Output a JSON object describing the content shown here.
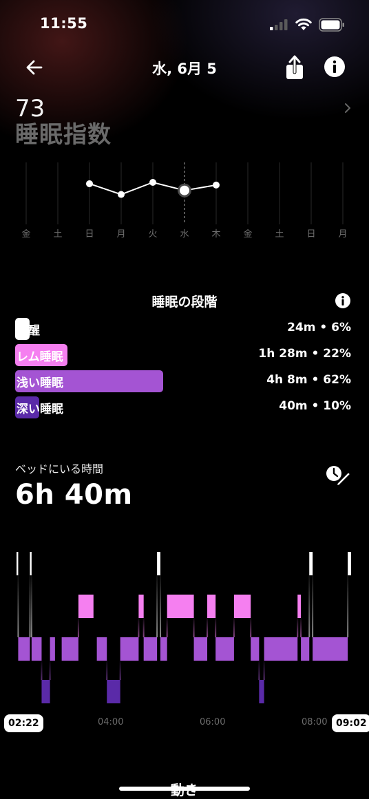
{
  "status": {
    "time": "11:55"
  },
  "header": {
    "date": "水, 6月 5"
  },
  "score": {
    "value": "73",
    "label": "睡眠指数"
  },
  "week": {
    "days": [
      "金",
      "土",
      "日",
      "月",
      "火",
      "水",
      "木",
      "金",
      "土",
      "日",
      "月"
    ],
    "values": [
      null,
      null,
      78,
      70,
      79,
      73,
      77,
      null,
      null,
      null,
      null
    ],
    "selected_index": 5
  },
  "stages": {
    "title": "睡眠の段階",
    "items": [
      {
        "label": "覚醒",
        "value": "24m • 6%",
        "percent": 6,
        "color": "#ffffff"
      },
      {
        "label": "レム睡眠",
        "value": "1h 28m • 22%",
        "percent": 22,
        "color": "#f57ff0"
      },
      {
        "label": "浅い睡眠",
        "value": "4h 8m • 62%",
        "percent": 62,
        "color": "#a454d3"
      },
      {
        "label": "深い睡眠",
        "value": "40m • 10%",
        "percent": 10,
        "color": "#5a2aa8"
      }
    ]
  },
  "in_bed": {
    "label": "ベッドにいる時間",
    "value": "6h 40m"
  },
  "hypnogram": {
    "start_label": "02:22",
    "end_label": "09:02",
    "ticks": [
      "04:00",
      "06:00",
      "08:00"
    ],
    "colors": {
      "awake": "#ffffff",
      "rem": "#f57ff0",
      "light": "#a454d3",
      "deep": "#5a2aa8"
    },
    "segments": [
      {
        "stage": "awake",
        "start": "02:22",
        "end": "02:24"
      },
      {
        "stage": "light",
        "start": "02:24",
        "end": "02:38"
      },
      {
        "stage": "awake",
        "start": "02:38",
        "end": "02:40"
      },
      {
        "stage": "light",
        "start": "02:40",
        "end": "02:52"
      },
      {
        "stage": "deep",
        "start": "02:52",
        "end": "03:02"
      },
      {
        "stage": "light",
        "start": "03:02",
        "end": "03:08"
      },
      {
        "stage": "light",
        "start": "03:16",
        "end": "03:36"
      },
      {
        "stage": "rem",
        "start": "03:36",
        "end": "03:54"
      },
      {
        "stage": "light",
        "start": "03:58",
        "end": "04:10"
      },
      {
        "stage": "deep",
        "start": "04:10",
        "end": "04:26"
      },
      {
        "stage": "light",
        "start": "04:26",
        "end": "04:48"
      },
      {
        "stage": "rem",
        "start": "04:48",
        "end": "04:54"
      },
      {
        "stage": "light",
        "start": "04:54",
        "end": "05:10"
      },
      {
        "stage": "awake",
        "start": "05:10",
        "end": "05:14"
      },
      {
        "stage": "light",
        "start": "05:14",
        "end": "05:22"
      },
      {
        "stage": "rem",
        "start": "05:22",
        "end": "05:54"
      },
      {
        "stage": "light",
        "start": "05:54",
        "end": "06:10"
      },
      {
        "stage": "rem",
        "start": "06:10",
        "end": "06:20"
      },
      {
        "stage": "light",
        "start": "06:20",
        "end": "06:42"
      },
      {
        "stage": "rem",
        "start": "06:42",
        "end": "07:02"
      },
      {
        "stage": "light",
        "start": "07:02",
        "end": "07:12"
      },
      {
        "stage": "deep",
        "start": "07:12",
        "end": "07:18"
      },
      {
        "stage": "light",
        "start": "07:18",
        "end": "07:58"
      },
      {
        "stage": "rem",
        "start": "07:58",
        "end": "08:02"
      },
      {
        "stage": "light",
        "start": "08:02",
        "end": "08:12"
      },
      {
        "stage": "awake",
        "start": "08:12",
        "end": "08:16"
      },
      {
        "stage": "light",
        "start": "08:16",
        "end": "08:58"
      },
      {
        "stage": "awake",
        "start": "08:58",
        "end": "09:02"
      }
    ]
  },
  "bottom": {
    "label": "動き"
  }
}
